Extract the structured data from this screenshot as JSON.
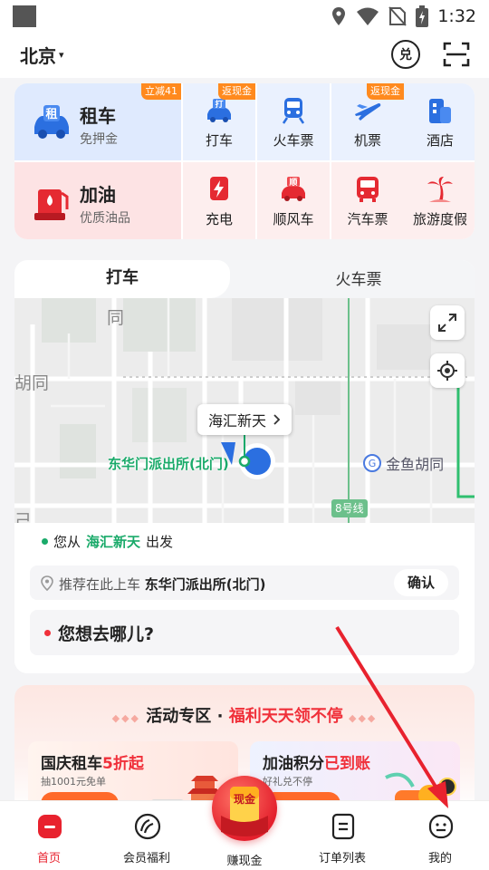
{
  "status_bar": {
    "time": "1:32"
  },
  "header": {
    "city": "北京",
    "city_caret": "▾",
    "exchange_icon_text": "兑"
  },
  "services": {
    "rent": {
      "title": "租车",
      "subtitle": "免押金",
      "badge": "立减41",
      "icon_text": "租"
    },
    "fuel": {
      "title": "加油",
      "subtitle": "优质油品"
    },
    "row1": [
      {
        "label": "打车",
        "badge": "返现金",
        "icon": "taxi-icon"
      },
      {
        "label": "火车票",
        "badge": "",
        "icon": "train-icon"
      },
      {
        "label": "机票",
        "badge": "返现金",
        "icon": "plane-icon"
      },
      {
        "label": "酒店",
        "badge": "",
        "icon": "hotel-icon"
      }
    ],
    "row2": [
      {
        "label": "充电",
        "icon": "charging-icon"
      },
      {
        "label": "顺风车",
        "icon": "carpool-icon"
      },
      {
        "label": "汽车票",
        "icon": "bus-icon"
      },
      {
        "label": "旅游度假",
        "icon": "vacation-icon"
      }
    ],
    "taxi_icon_text": "打",
    "carpool_icon_text": "顺"
  },
  "taxi_card": {
    "tabs": [
      "打车",
      "火车票"
    ],
    "map": {
      "poi_label": "海汇新天",
      "pickup_label": "东华门派出所(北门)",
      "metro_station": "金鱼胡同",
      "metro_line": "8号线",
      "street_fragments": [
        "同",
        "胡同",
        "己"
      ]
    },
    "from_prefix": "您从",
    "from_place": "海汇新天",
    "from_suffix": "出发",
    "recommend_prefix": "推荐在此上车",
    "recommend_place": "东华门派出所(北门)",
    "confirm_label": "确认",
    "destination_placeholder": "您想去哪儿?"
  },
  "activity": {
    "title_a": "活动专区",
    "title_sep": "·",
    "title_b": "福利天天领不停",
    "promos": [
      {
        "title": "国庆租车",
        "title_hl": "5折起",
        "subtitle": "抽1001元免单"
      },
      {
        "title": "加油积分",
        "title_hl": "已到账",
        "subtitle": "好礼兑不停"
      }
    ]
  },
  "earn_cash": {
    "label": "赚现金",
    "icon_text": "现金"
  },
  "bottom_nav": [
    {
      "label": "首页",
      "icon": "home-icon",
      "active": true
    },
    {
      "label": "会员福利",
      "icon": "member-icon",
      "active": false
    },
    {
      "label": "订单列表",
      "icon": "orders-icon",
      "active": false
    },
    {
      "label": "我的",
      "icon": "profile-icon",
      "active": false
    }
  ],
  "colors": {
    "brand_red": "#e8222e",
    "accent_blue": "#2b6fe0",
    "green": "#1aaa6a",
    "badge_orange": "#ff8a1e"
  }
}
